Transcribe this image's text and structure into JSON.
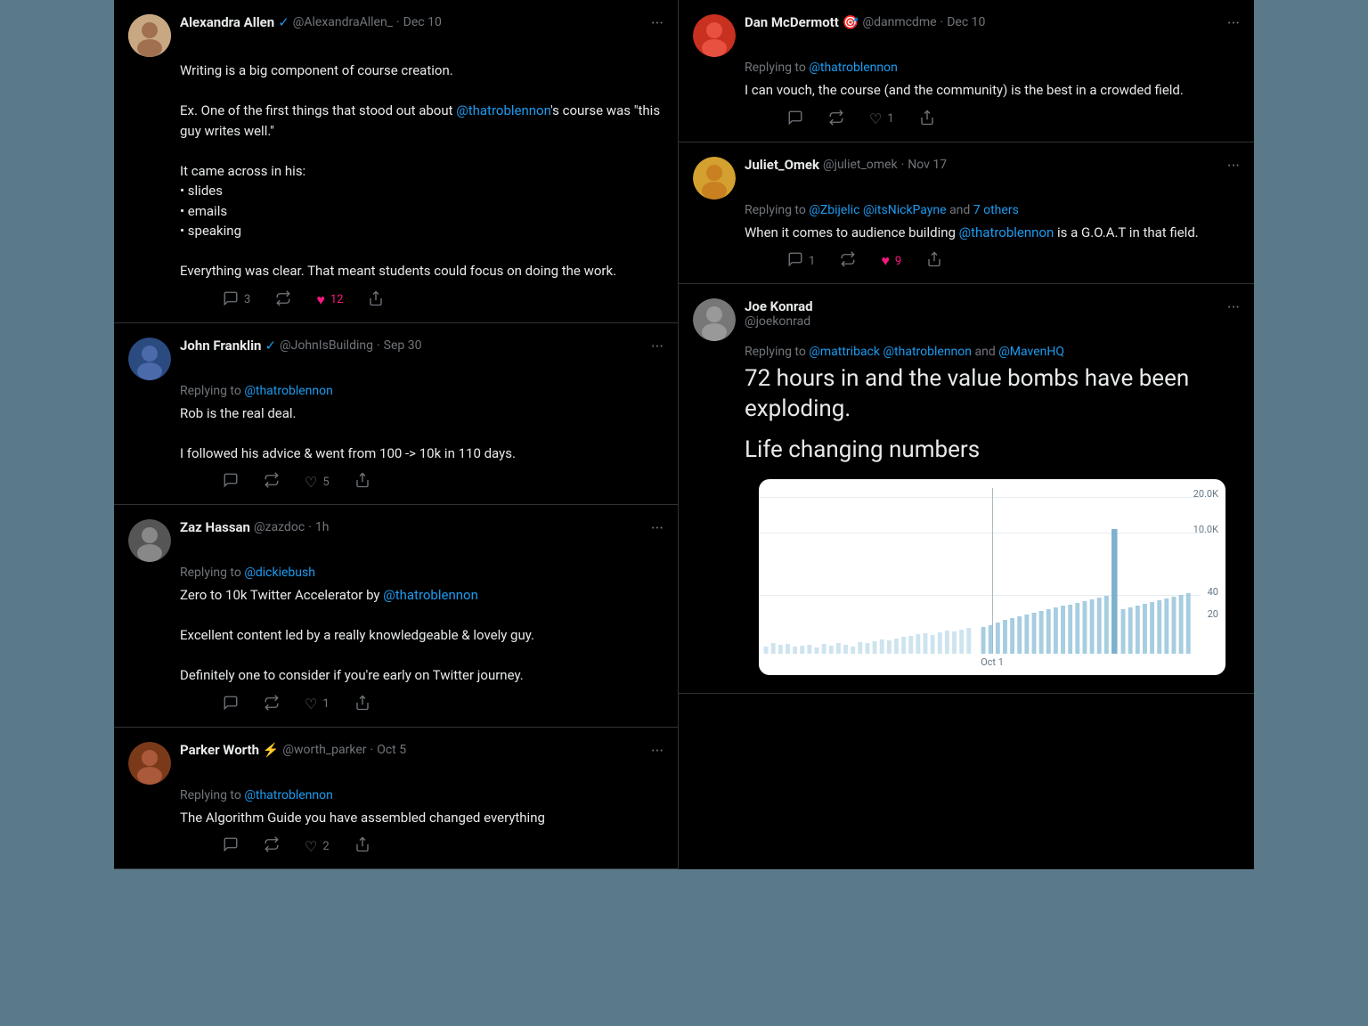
{
  "tweets": {
    "alexandra": {
      "name": "Alexandra Allen",
      "verified": true,
      "handle": "@AlexandraAllen_",
      "date": "Dec 10",
      "text": "Writing is a big component of course creation.\n\nEx. One of the first things that stood out about @thatroblennon's course was \"this guy writes well.\"\n\nIt came across in his:\n• slides\n• emails\n• speaking\n\nEverything was clear. That meant students could focus on doing the work.",
      "mention": "@thatroblennon",
      "actions": {
        "comments": "3",
        "retweets": "",
        "likes": "12",
        "share": ""
      }
    },
    "john": {
      "name": "John Franklin",
      "verified": true,
      "handle": "@JohnIsBuilding",
      "date": "Sep 30",
      "replying_to": "@thatroblennon",
      "text": "Rob is the real deal.\n\nI followed his advice & went from 100 -> 10k in 110 days.",
      "actions": {
        "comments": "",
        "retweets": "",
        "likes": "5",
        "share": ""
      }
    },
    "zaz": {
      "name": "Zaz Hassan",
      "handle": "@zazdoc",
      "date": "1h",
      "replying_to": "@dickiebush",
      "text1": "Zero to 10k Twitter Accelerator by @thatroblennon",
      "text2": "Excellent content led by a really knowledgeable & lovely guy.\n\nDefinitely one to consider if you're early on Twitter journey.",
      "actions": {
        "comments": "",
        "retweets": "",
        "likes": "1",
        "share": ""
      }
    },
    "parker": {
      "name": "Parker Worth",
      "emoji": "⚡",
      "handle": "@worth_parker",
      "date": "Oct 5",
      "replying_to": "@thatroblennon",
      "text": "The Algorithm Guide you have assembled changed everything",
      "actions": {
        "comments": "",
        "retweets": "",
        "likes": "2",
        "share": ""
      }
    },
    "dan": {
      "name": "Dan McDermott",
      "handle": "@danmcdme",
      "date": "Dec 10",
      "replying_to": "@thatroblennon",
      "text": "I can vouch, the course (and the community) is the best in a crowded field.",
      "actions": {
        "comments": "",
        "retweets": "",
        "likes": "1",
        "share": ""
      }
    },
    "juliet": {
      "name": "Juliet_Omek",
      "handle": "@juliet_omek",
      "date": "Nov 17",
      "replying_to": "@Zbijelic @itsNickPayne and 7 others",
      "text": "When it comes to audience building @thatroblennon is a G.O.A.T in that field.",
      "actions": {
        "comments": "1",
        "retweets": "",
        "likes": "9",
        "share": ""
      }
    },
    "joe": {
      "name": "Joe Konrad",
      "handle": "@joekonrad",
      "replying_to": "@mattriback @thatroblennon and @MavenHQ",
      "text1": "72 hours in and the value bombs have been exploding.",
      "text2": "Life changing numbers",
      "chart": {
        "y_labels": [
          "20.0K",
          "10.0K",
          "40",
          "20"
        ],
        "x_label": "Oct 1"
      }
    }
  },
  "icons": {
    "comment": "💬",
    "retweet": "🔄",
    "heart": "♥",
    "share": "↑",
    "more": "···"
  }
}
